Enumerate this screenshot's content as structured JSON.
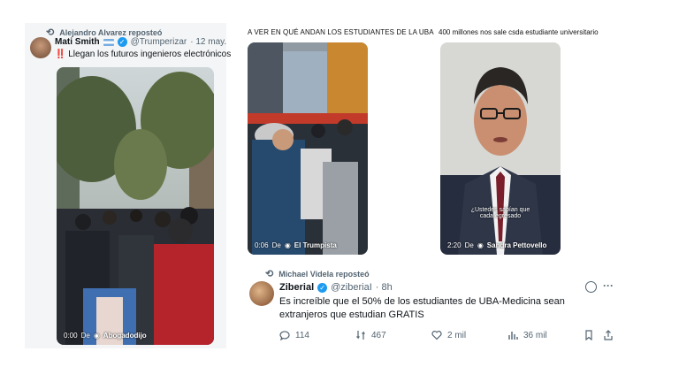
{
  "post1": {
    "repost_by": "Alejandro Alvarez reposteó",
    "author_name": "Mati Smith",
    "handle": "@Trumperizar",
    "date": "· 12 may.",
    "bang": "‼️",
    "text": "Llegan los futuros ingenieros electrónicos",
    "video_time": "0:00",
    "video_from": "De",
    "video_source": "Abogadodijo"
  },
  "mid_panel": {
    "caption": "A VER EN QUÉ ANDAN LOS ESTUDIANTES DE LA UBA",
    "video_time": "0:06",
    "video_from": "De",
    "video_source": "El Trumpista"
  },
  "right_panel": {
    "caption": "400 millones nos sale csda estudiante universitario",
    "subtitle": "¿Ustedes sabían que cada egresado",
    "video_time": "2:20",
    "video_from": "De",
    "video_source": "Sandra Pettovello"
  },
  "post2": {
    "repost_by": "Michael Videla reposteó",
    "author_name": "Ziberial",
    "handle": "@ziberiaI",
    "date": "· 8h",
    "text_line1": "Es increíble que el 50% de los estudiantes de UBA-Medicina sean",
    "text_line2": "extranjeros que estudian GRATIS",
    "replies": "114",
    "reposts": "467",
    "likes": "2 mil",
    "views": "36 mil"
  },
  "colors": {
    "verified": "#1d9bf0",
    "muted": "#536471",
    "text": "#0f1419"
  }
}
